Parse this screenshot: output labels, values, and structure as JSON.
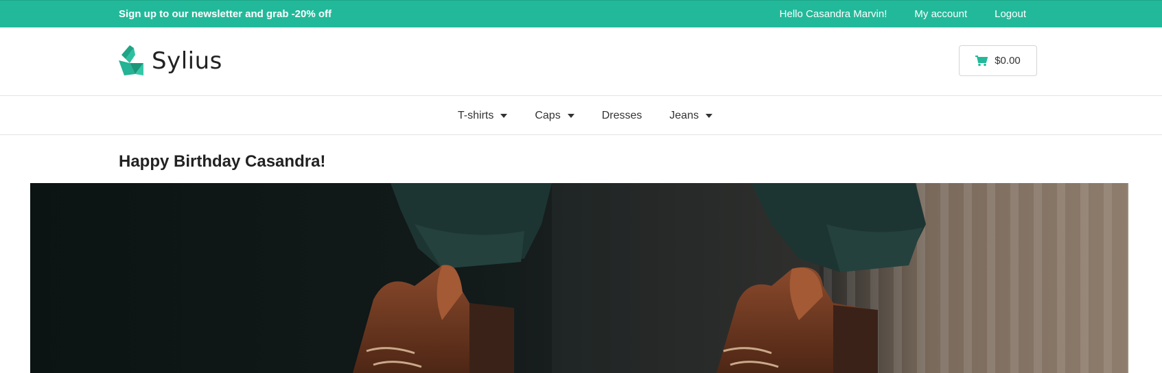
{
  "topbar": {
    "promo": "Sign up to our newsletter and grab -20% off",
    "greeting": "Hello Casandra Marvin!",
    "my_account": "My account",
    "logout": "Logout"
  },
  "header": {
    "logo_text": "Sylius",
    "cart_total": "$0.00"
  },
  "nav": {
    "items": [
      {
        "label": "T-shirts",
        "has_dropdown": true
      },
      {
        "label": "Caps",
        "has_dropdown": true
      },
      {
        "label": "Dresses",
        "has_dropdown": false
      },
      {
        "label": "Jeans",
        "has_dropdown": true
      }
    ]
  },
  "main": {
    "title": "Happy Birthday Casandra!"
  },
  "colors": {
    "accent": "#22b99a",
    "text_dark": "#222222"
  }
}
